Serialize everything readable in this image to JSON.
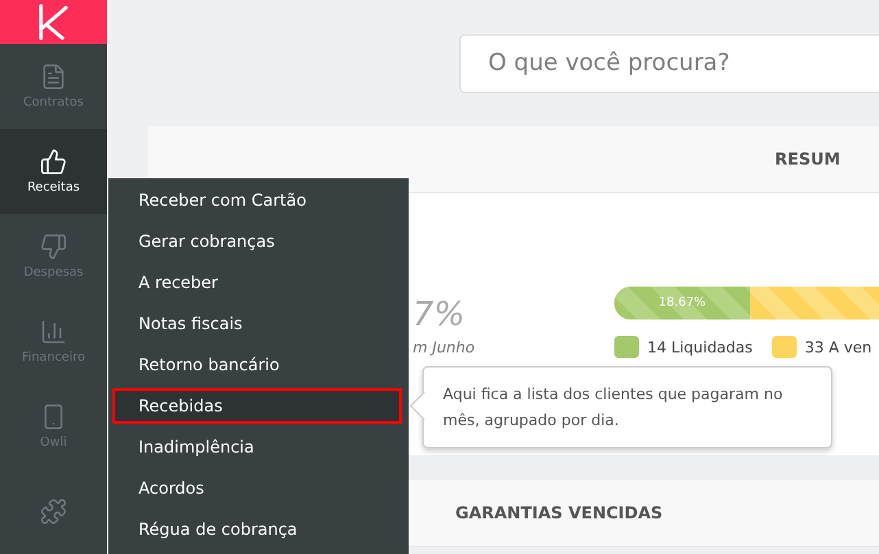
{
  "sidebar": {
    "items": [
      {
        "kind": "document",
        "label": "Contratos",
        "selected": false
      },
      {
        "kind": "thumbs-up",
        "label": "Receitas",
        "selected": true
      },
      {
        "kind": "thumbs-down",
        "label": "Despesas",
        "selected": false
      },
      {
        "kind": "chart",
        "label": "Financeiro",
        "selected": false
      },
      {
        "kind": "phone",
        "label": "Owli",
        "selected": false
      },
      {
        "kind": "puzzle",
        "selected": false
      }
    ]
  },
  "search": {
    "placeholder": "O que você procura?"
  },
  "summary": {
    "header": "RESUM",
    "percent": "7%",
    "caption": "m Junho",
    "progress": {
      "level": 0.1867,
      "label": "18.67%"
    },
    "legend": [
      {
        "label": "14 Liquidadas",
        "color": "#a4c96a"
      },
      {
        "label": "33 A ven",
        "color": "#fdd55c"
      }
    ]
  },
  "guarantees": {
    "header": "GARANTIAS VENCIDAS"
  },
  "menu": {
    "items": [
      {
        "label": "Receber com Cartão",
        "selected": false
      },
      {
        "label": "Gerar cobranças",
        "selected": false
      },
      {
        "label": "A receber",
        "selected": false
      },
      {
        "label": "Notas fiscais",
        "selected": false
      },
      {
        "label": "Retorno bancário",
        "selected": false
      },
      {
        "label": "Recebidas",
        "selected": true
      },
      {
        "label": "Inadimplência",
        "selected": false
      },
      {
        "label": "Acordos",
        "selected": false
      },
      {
        "label": "Régua de cobrança",
        "selected": false
      }
    ]
  },
  "tooltip": {
    "text": "Aqui fica a lista dos clientes que pagaram no mês, agrupado por dia."
  }
}
